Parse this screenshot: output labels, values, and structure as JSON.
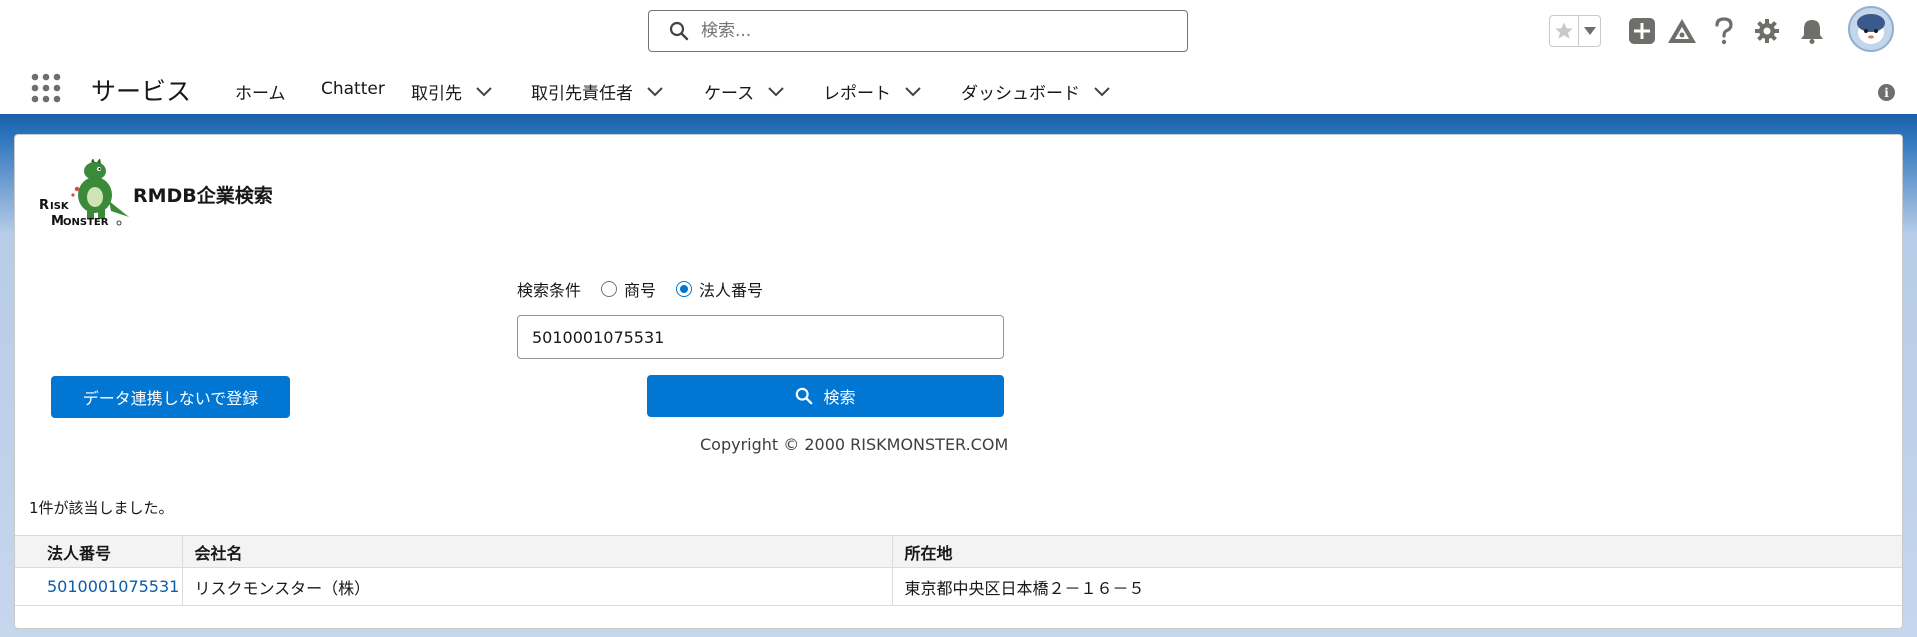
{
  "header": {
    "search_placeholder": "検索..."
  },
  "nav": {
    "app_name": "サービス",
    "items": [
      {
        "label": "ホーム",
        "has_menu": false
      },
      {
        "label": "Chatter",
        "has_menu": false
      },
      {
        "label": "取引先",
        "has_menu": true
      },
      {
        "label": "取引先責任者",
        "has_menu": true
      },
      {
        "label": "ケース",
        "has_menu": true
      },
      {
        "label": "レポート",
        "has_menu": true
      },
      {
        "label": "ダッシュボード",
        "has_menu": true
      }
    ],
    "info_glyph": "i"
  },
  "card": {
    "title": "RMDB企業検索",
    "criteria_label": "検索条件",
    "radio_options": [
      {
        "label": "商号",
        "selected": false
      },
      {
        "label": "法人番号",
        "selected": true
      }
    ],
    "input_value": "5010001075531",
    "register_button": "データ連携しないで登録",
    "search_button": "検索",
    "copyright": "Copyright © 2000 RISKMONSTER.COM",
    "result_count": "1件が該当しました。"
  },
  "results": {
    "columns": [
      "法人番号",
      "会社名",
      "所在地"
    ],
    "rows": [
      {
        "corp_number": "5010001075531",
        "company": "リスクモンスター（株）",
        "address": "東京都中央区日本橋２－１６－５"
      }
    ]
  },
  "colors": {
    "brand_blue": "#0176d3",
    "link_blue": "#0b5cab",
    "band_blue": "#1b5fa8"
  }
}
